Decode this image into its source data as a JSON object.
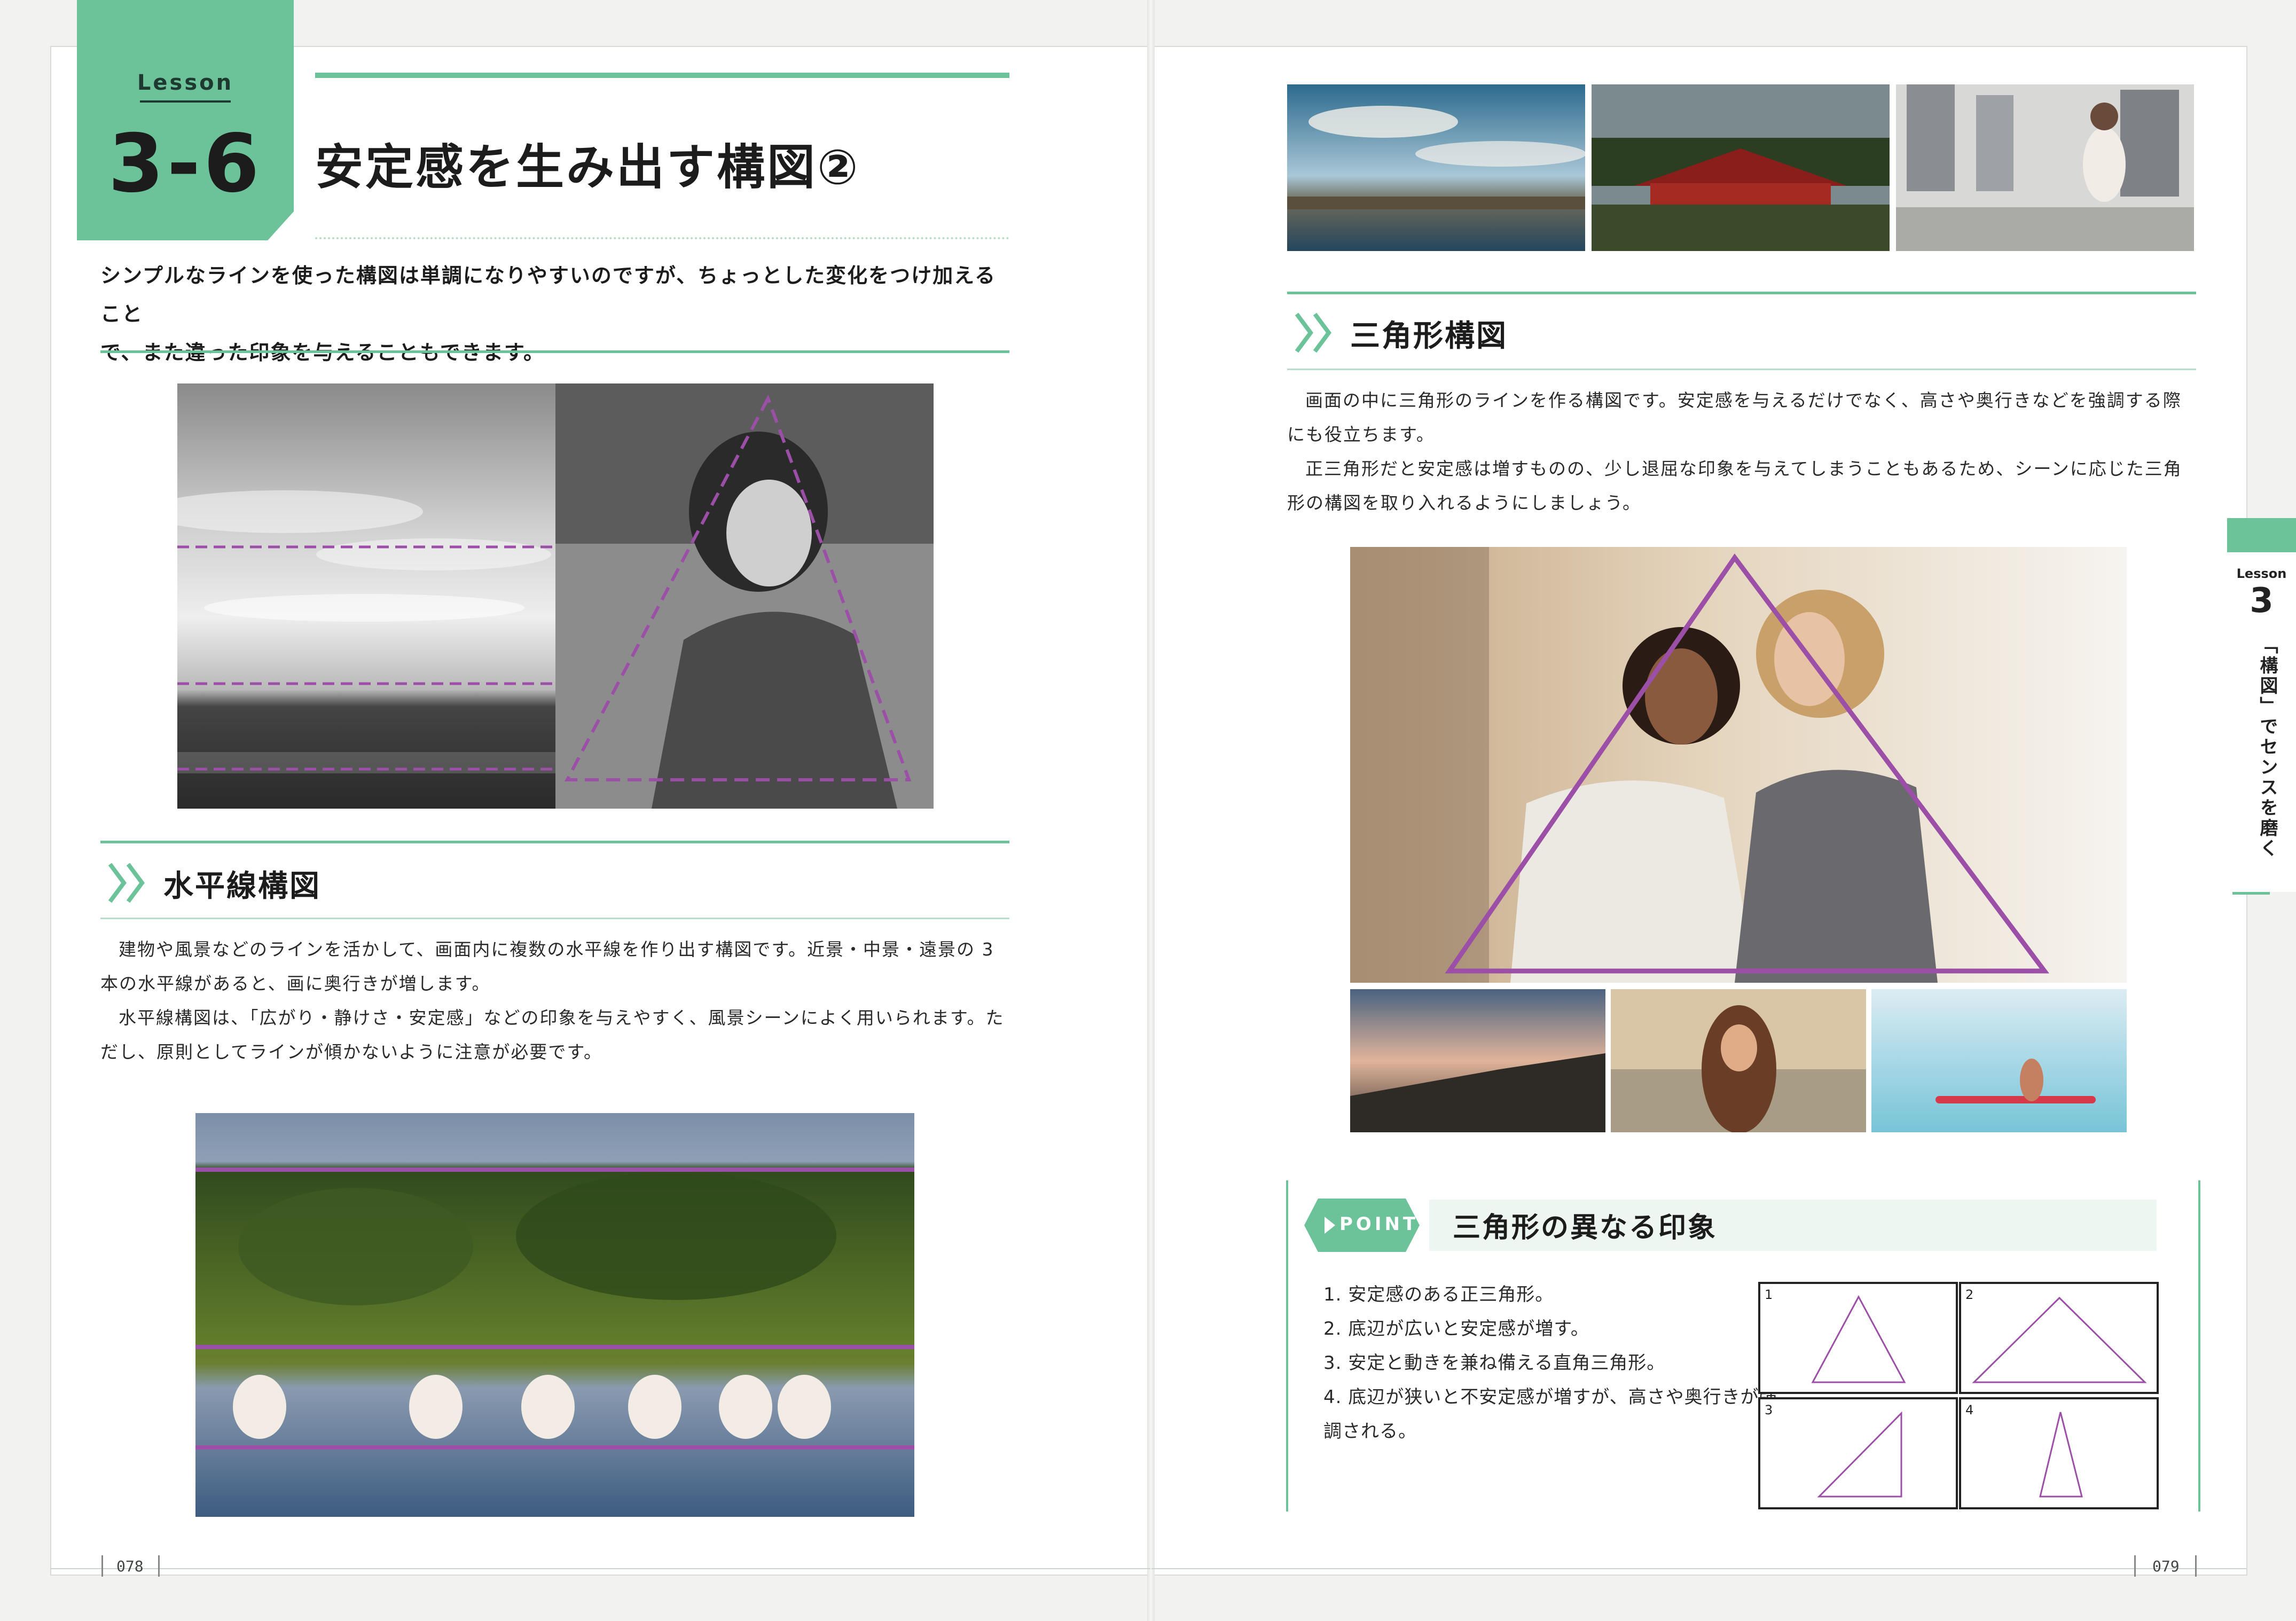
{
  "left_page": {
    "lesson_label": "Lesson",
    "lesson_number": "3-6",
    "title": "安定感を生み出す構図②",
    "intro_line1": "シンプルなラインを使った構図は単調になりやすいのですが、ちょっとした変化をつけ加えること",
    "intro_line2": "で、また違った印象を与えることもできます。",
    "section_heading": "水平線構図",
    "section_body_p1": "建物や風景などのラインを活かして、画面内に複数の水平線を作り出す構図です。近景・中景・遠景の 3 本の水平線があると、画に奥行きが増します。",
    "section_body_p2": "水平線構図は、「広がり・静けさ・安定感」などの印象を与えやすく、風景シーンによく用いられます。ただし、原則としてラインが傾かないように注意が必要です。",
    "page_number": "078"
  },
  "right_page": {
    "section_heading": "三角形構図",
    "section_body_p1": "画面の中に三角形のラインを作る構図です。安定感を与えるだけでなく、高さや奥行きなどを強調する際にも役立ちます。",
    "section_body_p2": "正三角形だと安定感は増すものの、少し退屈な印象を与えてしまうこともあるため、シーンに応じた三角形の構図を取り入れるようにしましょう。",
    "point_badge": "POINT",
    "point_title": "三角形の異なる印象",
    "point_items": [
      "1. 安定感のある正三角形。",
      "2. 底辺が広いと安定感が増す。",
      "3. 安定と動きを兼ね備える直角三角形。",
      "4. 底辺が狭いと不安定感が増すが、高さや奥行きが強調される。"
    ],
    "diagram_labels": [
      "1",
      "2",
      "3",
      "4"
    ],
    "page_number": "079"
  },
  "side_tab": {
    "label": "Lesson",
    "number": "3",
    "chapter": "「構図」でセンスを磨く"
  },
  "colors": {
    "accent_green": "#6cc39a",
    "guide_purple": "#9b4fa6"
  }
}
